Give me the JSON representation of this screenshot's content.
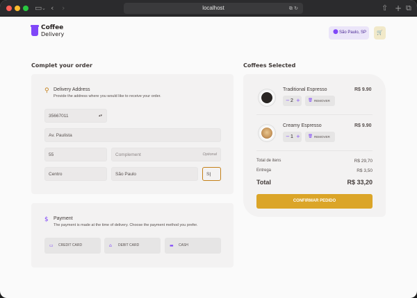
{
  "browser": {
    "url": "localhost"
  },
  "header": {
    "logo_line1": "Coffee",
    "logo_line2": "Delivery",
    "location": "São Paulo, SP"
  },
  "address_section": {
    "title": "Complet your order",
    "card_title": "Delivery Address",
    "card_subtitle": "Provide the address where you would like to receive your order.",
    "cep": "35667011",
    "street": "Av. Paulista",
    "number": "55",
    "complement_placeholder": "Complement",
    "optional_label": "Optional",
    "neighborhood": "Centro",
    "city": "São Paulo",
    "state": "S"
  },
  "payment": {
    "title": "Payment",
    "subtitle": "The payment is made at the time of delivery. Choose the payment method you prefer.",
    "options": [
      {
        "label": "CREDIT CARD",
        "icon": "credit-card-icon"
      },
      {
        "label": "DEBIT CARD",
        "icon": "bank-icon"
      },
      {
        "label": "CASH",
        "icon": "money-icon"
      }
    ]
  },
  "cart": {
    "title": "Coffees Selected",
    "items": [
      {
        "name": "Traditional Espresso",
        "price": "R$ 9.90",
        "qty": "2",
        "remove_label": "REMOVER"
      },
      {
        "name": "Creamy Espresso",
        "price": "R$ 9.90",
        "qty": "1",
        "remove_label": "REMOVER"
      }
    ],
    "items_total_label": "Total de itens",
    "items_total_value": "R$ 29,70",
    "delivery_label": "Entrega",
    "delivery_value": "R$ 3,50",
    "total_label": "Total",
    "total_value": "R$ 33,20",
    "confirm_label": "CONFIRMAR PEDIDO"
  },
  "colors": {
    "purple": "#8047f8",
    "yellow": "#dba528",
    "yellow_dark": "#c47f17"
  }
}
